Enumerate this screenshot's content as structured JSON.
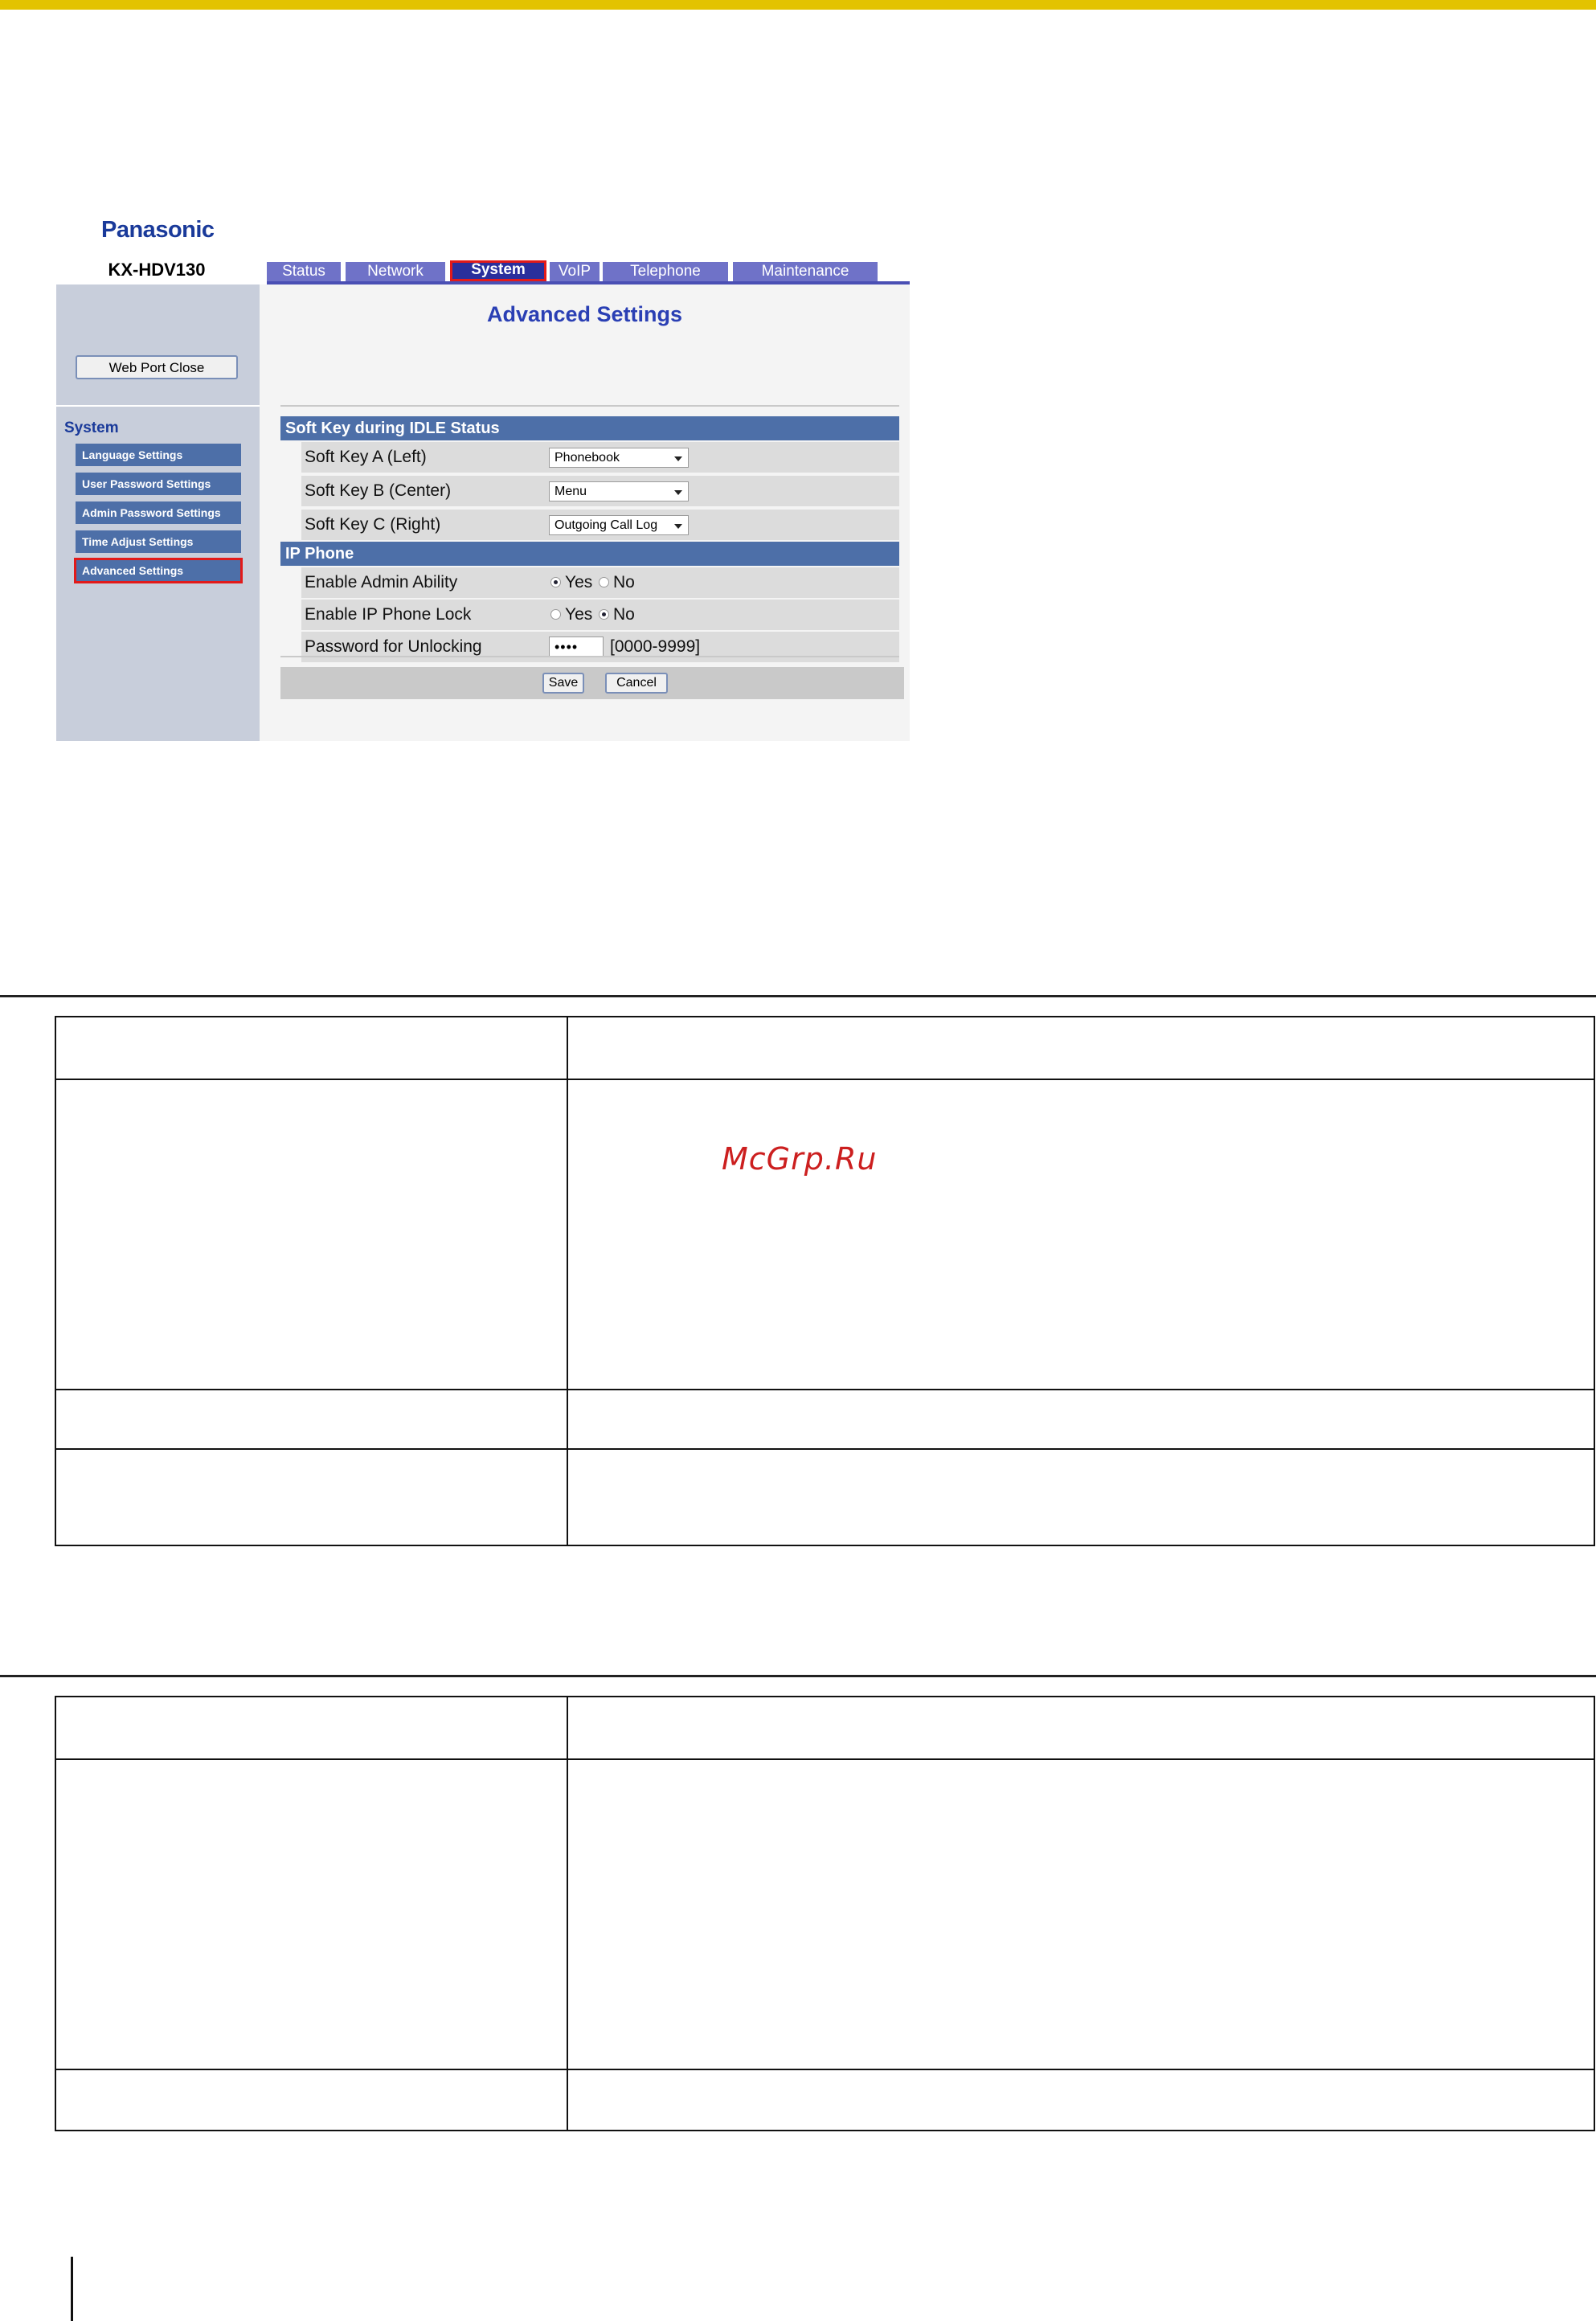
{
  "brand": {
    "logo": "Panasonic",
    "model": "KX-HDV130"
  },
  "tabs": [
    "Status",
    "Network",
    "System",
    "VoIP",
    "Telephone",
    "Maintenance"
  ],
  "active_tab": "System",
  "sidebar": {
    "button": "Web Port Close",
    "section_title": "System",
    "items": [
      "Language Settings",
      "User Password Settings",
      "Admin Password Settings",
      "Time Adjust Settings",
      "Advanced Settings"
    ],
    "active_item": "Advanced Settings"
  },
  "page_title": "Advanced Settings",
  "soft_key": {
    "section": "Soft Key during IDLE Status",
    "rows": [
      {
        "label": "Soft Key A (Left)",
        "value": "Phonebook"
      },
      {
        "label": "Soft Key B (Center)",
        "value": "Menu"
      },
      {
        "label": "Soft Key C (Right)",
        "value": "Outgoing Call Log"
      }
    ]
  },
  "ip_phone": {
    "section": "IP Phone",
    "admin": {
      "label": "Enable Admin Ability",
      "yes": "Yes",
      "no": "No",
      "selected": "Yes"
    },
    "lock": {
      "label": "Enable IP Phone Lock",
      "yes": "Yes",
      "no": "No",
      "selected": "No"
    },
    "password": {
      "label": "Password for Unlocking",
      "value": "••••",
      "range": "[0000-9999]"
    }
  },
  "footer": {
    "save": "Save",
    "cancel": "Cancel"
  },
  "watermark": "McGrp.Ru",
  "colors": {
    "accent_bar": "#e3c300",
    "tab": "#6f72c8",
    "tab_active": "#2a2f9c",
    "section": "#4d6fa8",
    "highlight": "#e21a1a"
  }
}
